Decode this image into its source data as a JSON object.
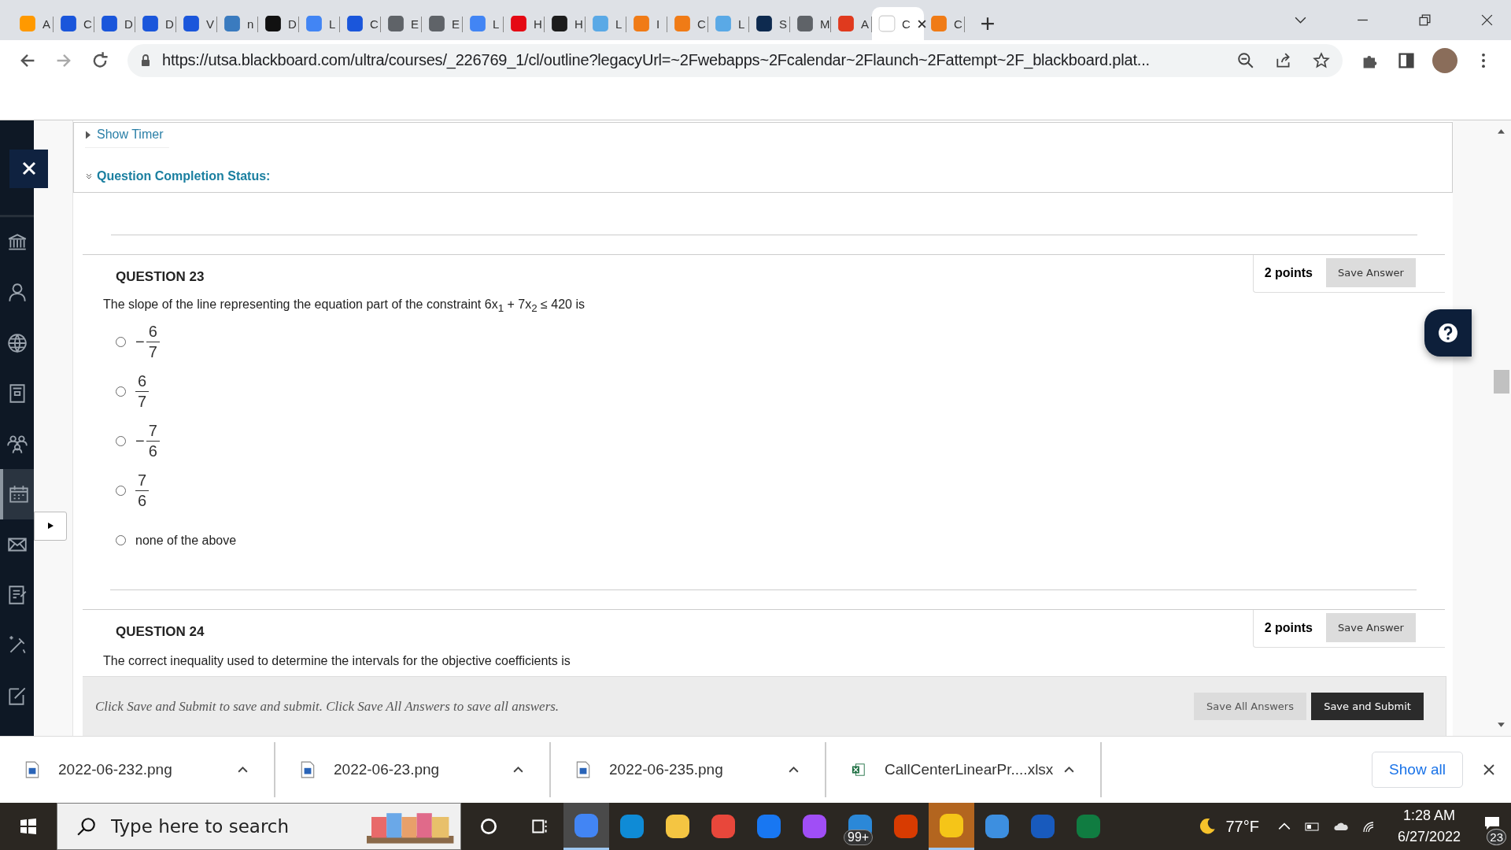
{
  "tabs": [
    {
      "label": "A",
      "color": "#ff9900",
      "selected": false
    },
    {
      "label": "C",
      "color": "#1a56db",
      "selected": false
    },
    {
      "label": "D",
      "color": "#1a56db",
      "selected": false
    },
    {
      "label": "D",
      "color": "#1a56db",
      "selected": false
    },
    {
      "label": "V",
      "color": "#1a56db",
      "selected": false
    },
    {
      "label": "n",
      "color": "#3a7bbf",
      "selected": false
    },
    {
      "label": "D",
      "color": "#111111",
      "selected": false
    },
    {
      "label": "L",
      "color": "#4285f4",
      "selected": false
    },
    {
      "label": "C",
      "color": "#1a56db",
      "selected": false
    },
    {
      "label": "E",
      "color": "#5f6368",
      "selected": false
    },
    {
      "label": "E",
      "color": "#5f6368",
      "selected": false
    },
    {
      "label": "L",
      "color": "#4285f4",
      "selected": false
    },
    {
      "label": "H",
      "color": "#e50914",
      "selected": false
    },
    {
      "label": "H",
      "color": "#1c1c1c",
      "selected": false
    },
    {
      "label": "L",
      "color": "#5aa9e6",
      "selected": false
    },
    {
      "label": "I",
      "color": "#f07b16",
      "selected": false
    },
    {
      "label": "C",
      "color": "#f07b16",
      "selected": false
    },
    {
      "label": "L",
      "color": "#5aa9e6",
      "selected": false
    },
    {
      "label": "S",
      "color": "#0e2a4f",
      "selected": false
    },
    {
      "label": "M",
      "color": "#5f6368",
      "selected": false
    },
    {
      "label": "A",
      "color": "#e03a1e",
      "selected": false
    },
    {
      "label": "C",
      "color": "#ffffff",
      "selected": true
    },
    {
      "label": "C",
      "color": "#f07b16",
      "selected": false
    }
  ],
  "address_bar": {
    "url": "https://utsa.blackboard.com/ultra/courses/_226769_1/cl/outline?legacyUrl=~2Fwebapps~2Fcalendar~2Flaunch~2Fattempt~2F_blackboard.plat..."
  },
  "sidebar": {
    "items": [
      {
        "kind": "institution",
        "selected": false
      },
      {
        "kind": "person",
        "selected": false
      },
      {
        "kind": "globe",
        "selected": false
      },
      {
        "kind": "courses",
        "selected": false
      },
      {
        "kind": "groups",
        "selected": false
      },
      {
        "kind": "calendar",
        "selected": true
      },
      {
        "kind": "mail",
        "selected": false
      },
      {
        "kind": "notes",
        "selected": false
      },
      {
        "kind": "tools",
        "selected": false
      },
      {
        "kind": "edit",
        "selected": false
      }
    ]
  },
  "test_header": {
    "show_timer": "Show Timer",
    "completion_status": "Question Completion Status:"
  },
  "questions": [
    {
      "title": "QUESTION 23",
      "points": "2 points",
      "save": "Save Answer",
      "prompt": "The slope of the line representing the equation part of the constraint 6x$_{1}$ + 7x$_{2}$ ≤ 420 is",
      "options": [
        {
          "kind": "fraction",
          "sign": "−",
          "numerator": "6",
          "denominator": "7",
          "selected": false
        },
        {
          "kind": "fraction",
          "numerator": "6",
          "denominator": "7",
          "selected": false
        },
        {
          "kind": "fraction",
          "sign": "−",
          "numerator": "7",
          "denominator": "6",
          "selected": false
        },
        {
          "kind": "fraction",
          "numerator": "7",
          "denominator": "6",
          "selected": false
        },
        {
          "kind": "text",
          "text": "none of the above",
          "selected": false
        }
      ]
    },
    {
      "title": "QUESTION 24",
      "points": "2 points",
      "save": "Save Answer",
      "prompt": "The correct inequality used to determine the intervals for the objective coefficients is"
    }
  ],
  "footer": {
    "instructions": "Click Save and Submit to save and submit. Click Save All Answers to save all answers.",
    "save_all": "Save All Answers",
    "submit": "Save and Submit"
  },
  "downloads": {
    "items": [
      {
        "name": "2022-06-232.png",
        "kind": "image"
      },
      {
        "name": "2022-06-23.png",
        "kind": "image"
      },
      {
        "name": "2022-06-235.png",
        "kind": "image"
      },
      {
        "name": "CallCenterLinearPr....xlsx",
        "kind": "sheet"
      }
    ],
    "show_all": "Show all"
  },
  "taskbar": {
    "search_placeholder": "Type here to search",
    "apps": [
      {
        "color": "#4285f4",
        "highlighted": true
      },
      {
        "color": "#0f8bd6",
        "highlighted": false
      },
      {
        "color": "#f4c542",
        "highlighted": false
      },
      {
        "color": "#e8473b",
        "highlighted": false
      },
      {
        "color": "#1877f2",
        "highlighted": false
      },
      {
        "color": "#a04ef6",
        "highlighted": false
      },
      {
        "color": "#2b88d8",
        "highlighted": false,
        "badge": "99+"
      },
      {
        "color": "#d83b01",
        "highlighted": false
      },
      {
        "color": "#f5c518",
        "highlighted": true
      },
      {
        "color": "#3d8fe0",
        "highlighted": false
      },
      {
        "color": "#185abd",
        "highlighted": false
      },
      {
        "color": "#107c41",
        "highlighted": false
      }
    ],
    "temperature": "77°F",
    "time": "1:28 AM",
    "date": "6/27/2022",
    "notifications": "23"
  }
}
